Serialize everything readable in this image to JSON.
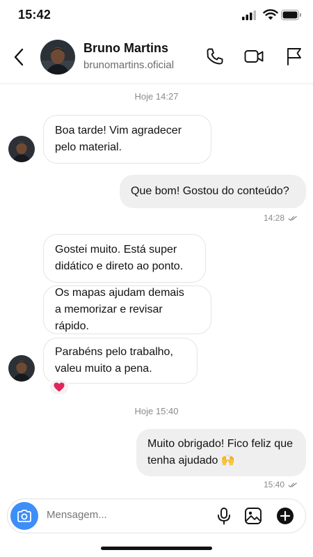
{
  "status_bar": {
    "time": "15:42"
  },
  "header": {
    "name": "Bruno Martins",
    "handle": "brunomartins.oficial"
  },
  "messages": [
    {
      "stamp": "Hoje 14:27"
    },
    {
      "text_lines": [
        "Boa tarde! Vim agradecer",
        "pelo material."
      ]
    },
    {
      "text_lines": [
        "Que bom! Gostou do conteúdo?"
      ],
      "time": "14:28"
    },
    {
      "text_lines": [
        "Gostei muito. Está super",
        "didático e direto ao ponto."
      ]
    },
    {
      "text_lines": [
        "Os mapas ajudam demais",
        "a memorizar e revisar rápido."
      ]
    },
    {
      "text_lines": [
        "Parabéns pelo trabalho,",
        "valeu muito a pena."
      ],
      "reaction": "❤️"
    },
    {
      "stamp": "Hoje 15:40"
    },
    {
      "text_lines": [
        "Muito obrigado! Fico feliz que",
        "tenha ajudado 🙌"
      ],
      "time": "15:40"
    }
  ],
  "composer": {
    "placeholder": "Mensagem..."
  },
  "colors": {
    "accent": "#3d8ef7",
    "outgoing_bubble": "#efefef",
    "reaction_heart": "#e0245e"
  }
}
